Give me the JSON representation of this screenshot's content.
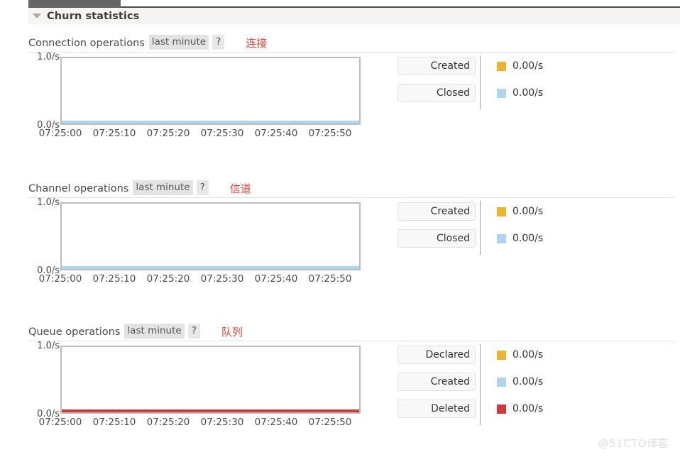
{
  "section": {
    "title": "Churn statistics",
    "caret_icon": "triangle-down-icon"
  },
  "watermark": "@51CTO博客",
  "blocks": [
    {
      "label": "Connection operations",
      "badge": "last minute",
      "help": "?",
      "annotation": "连接",
      "chart": {
        "y_top": "1.0/s",
        "y_bottom": "0.0/s",
        "baseline_color": "#aed4ef",
        "xticks": [
          "07:25:00",
          "07:25:10",
          "07:25:20",
          "07:25:30",
          "07:25:40",
          "07:25:50"
        ]
      },
      "legend": [
        {
          "label": "Created",
          "color": "#edb431",
          "value": "0.00/s"
        },
        {
          "label": "Closed",
          "color": "#aed4ef",
          "value": "0.00/s"
        }
      ]
    },
    {
      "label": "Channel operations",
      "badge": "last minute",
      "help": "?",
      "annotation": "信道",
      "chart": {
        "y_top": "1.0/s",
        "y_bottom": "0.0/s",
        "baseline_color": "#aed4ef",
        "xticks": [
          "07:25:00",
          "07:25:10",
          "07:25:20",
          "07:25:30",
          "07:25:40",
          "07:25:50"
        ]
      },
      "legend": [
        {
          "label": "Created",
          "color": "#edb431",
          "value": "0.00/s"
        },
        {
          "label": "Closed",
          "color": "#aed4ef",
          "value": "0.00/s"
        }
      ]
    },
    {
      "label": "Queue operations",
      "badge": "last minute",
      "help": "?",
      "annotation": "队列",
      "chart": {
        "y_top": "1.0/s",
        "y_bottom": "0.0/s",
        "baseline_color": "#cf3a3a",
        "xticks": [
          "07:25:00",
          "07:25:10",
          "07:25:20",
          "07:25:30",
          "07:25:40",
          "07:25:50"
        ]
      },
      "legend": [
        {
          "label": "Declared",
          "color": "#edb431",
          "value": "0.00/s"
        },
        {
          "label": "Created",
          "color": "#aed4ef",
          "value": "0.00/s"
        },
        {
          "label": "Deleted",
          "color": "#cf3a3a",
          "value": "0.00/s"
        }
      ]
    }
  ],
  "chart_data": [
    {
      "type": "line",
      "title": "Connection operations",
      "xlabel": "",
      "ylabel": "/s",
      "ylim": [
        0.0,
        1.0
      ],
      "yticks": [
        0.0,
        1.0
      ],
      "ytick_labels": [
        "0.0/s",
        "1.0/s"
      ],
      "x": [
        "07:25:00",
        "07:25:10",
        "07:25:20",
        "07:25:30",
        "07:25:40",
        "07:25:50"
      ],
      "grid": false,
      "legend_position": "right",
      "series": [
        {
          "name": "Created",
          "color": "#edb431",
          "values": [
            0,
            0,
            0,
            0,
            0,
            0
          ],
          "current": 0.0
        },
        {
          "name": "Closed",
          "color": "#aed4ef",
          "values": [
            0,
            0,
            0,
            0,
            0,
            0
          ],
          "current": 0.0
        }
      ]
    },
    {
      "type": "line",
      "title": "Channel operations",
      "xlabel": "",
      "ylabel": "/s",
      "ylim": [
        0.0,
        1.0
      ],
      "yticks": [
        0.0,
        1.0
      ],
      "ytick_labels": [
        "0.0/s",
        "1.0/s"
      ],
      "x": [
        "07:25:00",
        "07:25:10",
        "07:25:20",
        "07:25:30",
        "07:25:40",
        "07:25:50"
      ],
      "grid": false,
      "legend_position": "right",
      "series": [
        {
          "name": "Created",
          "color": "#edb431",
          "values": [
            0,
            0,
            0,
            0,
            0,
            0
          ],
          "current": 0.0
        },
        {
          "name": "Closed",
          "color": "#aed4ef",
          "values": [
            0,
            0,
            0,
            0,
            0,
            0
          ],
          "current": 0.0
        }
      ]
    },
    {
      "type": "line",
      "title": "Queue operations",
      "xlabel": "",
      "ylabel": "/s",
      "ylim": [
        0.0,
        1.0
      ],
      "yticks": [
        0.0,
        1.0
      ],
      "ytick_labels": [
        "0.0/s",
        "1.0/s"
      ],
      "x": [
        "07:25:00",
        "07:25:10",
        "07:25:20",
        "07:25:30",
        "07:25:40",
        "07:25:50"
      ],
      "grid": false,
      "legend_position": "right",
      "series": [
        {
          "name": "Declared",
          "color": "#edb431",
          "values": [
            0,
            0,
            0,
            0,
            0,
            0
          ],
          "current": 0.0
        },
        {
          "name": "Created",
          "color": "#aed4ef",
          "values": [
            0,
            0,
            0,
            0,
            0,
            0
          ],
          "current": 0.0
        },
        {
          "name": "Deleted",
          "color": "#cf3a3a",
          "values": [
            0,
            0,
            0,
            0,
            0,
            0
          ],
          "current": 0.0
        }
      ]
    }
  ]
}
